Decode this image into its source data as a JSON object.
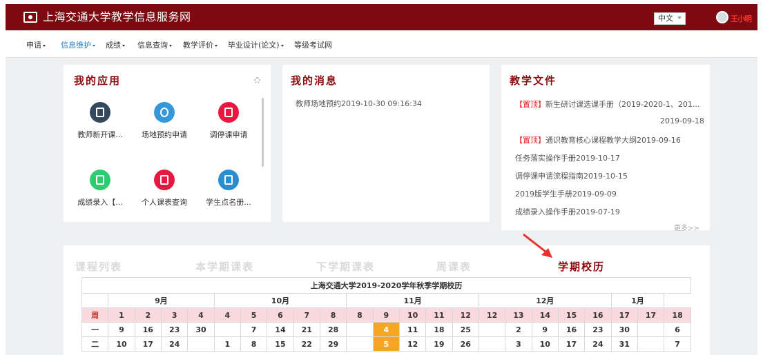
{
  "header": {
    "site_title": "上海交通大学教学信息服务网",
    "language": "中文",
    "user_name": "王小明"
  },
  "nav": [
    {
      "label": "申请",
      "dropdown": true
    },
    {
      "label": "信息维护",
      "dropdown": true,
      "active": true
    },
    {
      "label": "成绩",
      "dropdown": true
    },
    {
      "label": "信息查询",
      "dropdown": true
    },
    {
      "label": "教学评价",
      "dropdown": true
    },
    {
      "label": "毕业设计(论文)",
      "dropdown": true
    },
    {
      "label": "等级考试网",
      "dropdown": false
    }
  ],
  "apps_panel": {
    "title": "我的应用",
    "apps": [
      {
        "label": "教师新开课...",
        "icon": "document-icon",
        "color": "#34495e"
      },
      {
        "label": "场地预约申请",
        "icon": "location-icon",
        "color": "#3498db"
      },
      {
        "label": "调停课申请",
        "icon": "hand-pointer-icon",
        "color": "#e8173f"
      },
      {
        "label": "成绩录入【...",
        "icon": "cup-icon",
        "color": "#2ecc71"
      },
      {
        "label": "个人课表查询",
        "icon": "search-document-icon",
        "color": "#e8173f"
      },
      {
        "label": "学生点名册...",
        "icon": "roster-icon",
        "color": "#2a8fd0"
      }
    ]
  },
  "messages_panel": {
    "title": "我的消息",
    "items": [
      "教师场地预约2019-10-30 09:16:34"
    ]
  },
  "docs_panel": {
    "title": "教学文件",
    "pinned_tag": "【置顶】",
    "items": [
      {
        "pinned": true,
        "text": "新生研讨课选课手册（2019-2020-1、201...",
        "date": "2019-09-18"
      },
      {
        "pinned": true,
        "text": "通识教育核心课程教学大纲2019-09-16"
      },
      {
        "pinned": false,
        "text": "任务落实操作手册2019-10-17"
      },
      {
        "pinned": false,
        "text": "调停课申请流程指南2019-10-15"
      },
      {
        "pinned": false,
        "text": "2019版学生手册2019-09-09"
      },
      {
        "pinned": false,
        "text": "成绩录入操作手册2019-07-19"
      }
    ],
    "more": "更多>>"
  },
  "schedule_tabs": [
    "课程列表",
    "本学期课表",
    "下学期课表",
    "周课表",
    "学期校历"
  ],
  "active_tab": 4,
  "calendar": {
    "caption": "上海交通大学2019-2020学年秋季学期校历",
    "months": [
      {
        "label": "9月",
        "span": 4
      },
      {
        "label": "10月",
        "span": 5
      },
      {
        "label": "11月",
        "span": 5
      },
      {
        "label": "12月",
        "span": 5
      },
      {
        "label": "1月",
        "span": 2
      }
    ],
    "week_label": "周",
    "weeks": [
      "1",
      "2",
      "3",
      "4",
      "4",
      "5",
      "6",
      "7",
      "8",
      "8",
      "9",
      "10",
      "11",
      "12",
      "12",
      "13",
      "14",
      "15",
      "16",
      "17",
      "17",
      "18"
    ],
    "rows": [
      {
        "day": "一",
        "cells": [
          "9",
          "16",
          "23",
          "30",
          "",
          "7",
          "14",
          "21",
          "28",
          "",
          "4",
          "11",
          "18",
          "25",
          "",
          "2",
          "9",
          "16",
          "23",
          "30",
          "",
          "6"
        ],
        "highlight": 10
      },
      {
        "day": "二",
        "cells": [
          "10",
          "17",
          "24",
          "",
          "1",
          "8",
          "15",
          "22",
          "29",
          "",
          "5",
          "12",
          "19",
          "26",
          "",
          "3",
          "10",
          "17",
          "24",
          "31",
          "",
          "7"
        ],
        "highlight": 10
      }
    ]
  },
  "colors": {
    "brand": "#7c0a10",
    "title_red": "#8b0a10",
    "nav_active": "#2a7fc0",
    "week_row_bg": "#f9d9dc",
    "highlight": "#f5a623",
    "pin_red": "#e02020"
  }
}
